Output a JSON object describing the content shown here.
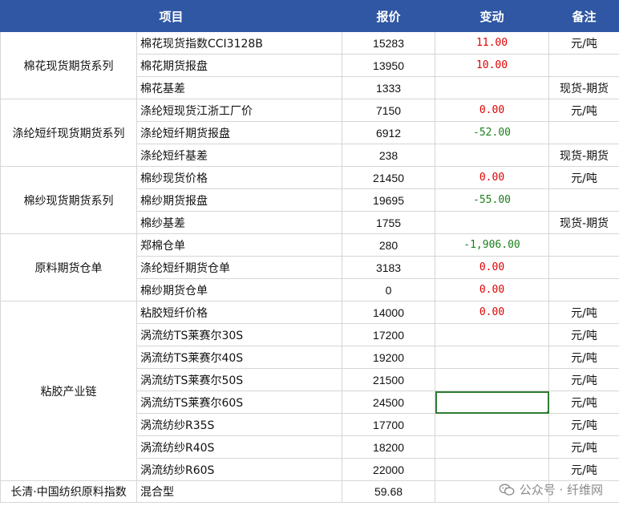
{
  "header": {
    "item": "项目",
    "price": "报价",
    "change": "变动",
    "note": "备注"
  },
  "groups": [
    {
      "name": "棉花现货期货系列",
      "rows": [
        {
          "item": "棉花现货指数CCI3128B",
          "price": "15283",
          "change": "11.00",
          "dir": "pos",
          "note": "元/吨"
        },
        {
          "item": "棉花期货报盘",
          "price": "13950",
          "change": "10.00",
          "dir": "pos",
          "note": ""
        },
        {
          "item": "棉花基差",
          "price": "1333",
          "change": "",
          "dir": "",
          "note": "现货-期货"
        }
      ]
    },
    {
      "name": "涤纶短纤现货期货系列",
      "rows": [
        {
          "item": "涤纶短现货江浙工厂价",
          "price": "7150",
          "change": "0.00",
          "dir": "pos",
          "note": "元/吨"
        },
        {
          "item": "涤纶短纤期货报盘",
          "price": "6912",
          "change": "-52.00",
          "dir": "neg",
          "note": ""
        },
        {
          "item": "涤纶短纤基差",
          "price": "238",
          "change": "",
          "dir": "",
          "note": "现货-期货"
        }
      ]
    },
    {
      "name": "棉纱现货期货系列",
      "rows": [
        {
          "item": "棉纱现货价格",
          "price": "21450",
          "change": "0.00",
          "dir": "pos",
          "note": "元/吨"
        },
        {
          "item": "棉纱期货报盘",
          "price": "19695",
          "change": "-55.00",
          "dir": "neg",
          "note": ""
        },
        {
          "item": "棉纱基差",
          "price": "1755",
          "change": "",
          "dir": "",
          "note": "现货-期货"
        }
      ]
    },
    {
      "name": "原料期货仓单",
      "rows": [
        {
          "item": "郑棉仓单",
          "price": "280",
          "change": "-1,906.00",
          "dir": "neg",
          "note": ""
        },
        {
          "item": "涤纶短纤期货仓单",
          "price": "3183",
          "change": "0.00",
          "dir": "pos",
          "note": ""
        },
        {
          "item": "棉纱期货仓单",
          "price": "0",
          "change": "0.00",
          "dir": "pos",
          "note": ""
        }
      ]
    },
    {
      "name": "粘胶产业链",
      "rows": [
        {
          "item": "粘胶短纤价格",
          "price": "14000",
          "change": "0.00",
          "dir": "pos",
          "note": "元/吨"
        },
        {
          "item": "涡流纺TS莱赛尔30S",
          "price": "17200",
          "change": "",
          "dir": "",
          "note": "元/吨"
        },
        {
          "item": "涡流纺TS莱赛尔40S",
          "price": "19200",
          "change": "",
          "dir": "",
          "note": "元/吨"
        },
        {
          "item": "涡流纺TS莱赛尔50S",
          "price": "21500",
          "change": "",
          "dir": "",
          "note": "元/吨"
        },
        {
          "item": "涡流纺TS莱赛尔60S",
          "price": "24500",
          "change": "",
          "dir": "",
          "note": "元/吨",
          "selected": true
        },
        {
          "item": "涡流纺纱R35S",
          "price": "17700",
          "change": "",
          "dir": "",
          "note": "元/吨"
        },
        {
          "item": "涡流纺纱R40S",
          "price": "18200",
          "change": "",
          "dir": "",
          "note": "元/吨"
        },
        {
          "item": "涡流纺纱R60S",
          "price": "22000",
          "change": "",
          "dir": "",
          "note": "元/吨"
        }
      ]
    }
  ],
  "footer": {
    "label": "长清·中国纺织原料指数",
    "item": "混合型",
    "price": "59.68"
  },
  "watermark": {
    "text": "公众号 · 纤维网",
    "icon": "wechat-icon"
  }
}
